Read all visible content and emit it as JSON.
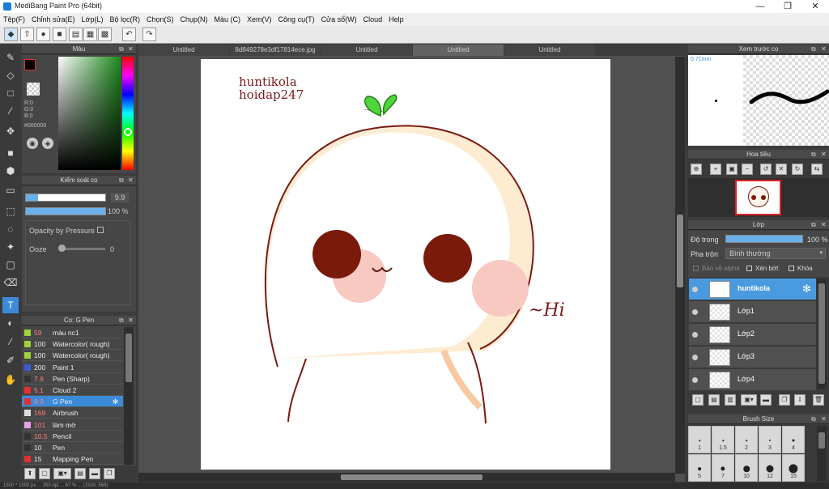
{
  "app": {
    "title": "MediBang Paint Pro (64bit)",
    "minimize": "—",
    "maximize": "❐",
    "close": "✕"
  },
  "menu": [
    "Tệp(F)",
    "Chỉnh sửa(E)",
    "Lớp(L)",
    "Bộ lọc(R)",
    "Chọn(S)",
    "Chụp(N)",
    "Màu (C)",
    "Xem(V)",
    "Công cụ(T)",
    "Cửa sổ(W)",
    "Cloud",
    "Help"
  ],
  "toolbar_icons": [
    "◆",
    "⇧",
    "●",
    "■",
    "▤",
    "▦",
    "▩",
    "↶",
    "↷"
  ],
  "tools": [
    "✎",
    "◇",
    "□",
    "∕",
    "✥",
    "■",
    "⬢",
    "▭",
    "⬚",
    "◌",
    "✦",
    "▢",
    "⌫",
    "T",
    "◐",
    "∕",
    "✐",
    "✋"
  ],
  "color_panel": {
    "title": "Màu",
    "r": "R:0",
    "g": "G:0",
    "b": "B:0",
    "hex": "#000000",
    "fg": "#000000",
    "bg": "#ffffff"
  },
  "brush_control": {
    "title": "Kiểm soát cọ",
    "size": "9.9",
    "opacity": "100 %",
    "pressure_label": "Opacity by Pressure",
    "ooze_label": "Ooze",
    "ooze_value": "0",
    "size_fill": 0.15,
    "opacity_fill": 1.0
  },
  "brush_list": {
    "title": "Cọ: G Pen",
    "items": [
      {
        "size": "59",
        "name": "màu nc1",
        "color": "#9fd23c",
        "size_red": true,
        "selected": false
      },
      {
        "size": "100",
        "name": "Watercolor( rough)",
        "color": "#9fd23c",
        "size_red": false,
        "selected": false
      },
      {
        "size": "100",
        "name": "Watercolor( rough)",
        "color": "#9fd23c",
        "size_red": false,
        "selected": false
      },
      {
        "size": "200",
        "name": "Paint 1",
        "color": "#3a5ad8",
        "size_red": false,
        "selected": false
      },
      {
        "size": "7.6",
        "name": "Pen (Sharp)",
        "color": "#333333",
        "size_red": true,
        "selected": false
      },
      {
        "size": "5.1",
        "name": "Cloud 2",
        "color": "#e03030",
        "size_red": true,
        "selected": false
      },
      {
        "size": "9.9",
        "name": "G Pen",
        "color": "#e03030",
        "size_red": true,
        "selected": true
      },
      {
        "size": "169",
        "name": "Airbrush",
        "color": "#dddddd",
        "size_red": true,
        "selected": false
      },
      {
        "size": "101",
        "name": "làm mờ",
        "color": "#e8a0e8",
        "size_red": true,
        "selected": false
      },
      {
        "size": "10.5",
        "name": "Pencil",
        "color": "#333333",
        "size_red": true,
        "selected": false
      },
      {
        "size": "10",
        "name": "Pen",
        "color": "#333333",
        "size_red": false,
        "selected": false
      },
      {
        "size": "15",
        "name": "Mapping Pen",
        "color": "#e03030",
        "size_red": false,
        "selected": false
      }
    ]
  },
  "tabs": [
    {
      "label": "Untitled",
      "active": false
    },
    {
      "label": "8d849278e3df17814ece.jpg",
      "active": false
    },
    {
      "label": "Untitled",
      "active": false
    },
    {
      "label": "Untitled",
      "active": true
    },
    {
      "label": "Untitled",
      "active": false
    }
  ],
  "artwork": {
    "line1": "huntikola",
    "line2": "hoidap247",
    "sign": "~Hi"
  },
  "preview": {
    "title": "Xem trước cọ",
    "size": "0.71mm"
  },
  "navigator": {
    "title": "Hoa tiêu"
  },
  "layers": {
    "title": "Lớp",
    "opacity_label": "Độ trong",
    "opacity_value": "100 %",
    "opacity_fill": 1.0,
    "blend_label": "Pha trộn",
    "blend_value": "Bình thường",
    "protect_alpha": "Bảo vệ alpha",
    "clipping": "Xén bớt",
    "lock": "Khóa",
    "items": [
      {
        "name": "huntikola",
        "selected": true
      },
      {
        "name": "Lớp1",
        "selected": false
      },
      {
        "name": "Lớp2",
        "selected": false
      },
      {
        "name": "Lớp3",
        "selected": false
      },
      {
        "name": "Lớp4",
        "selected": false
      }
    ]
  },
  "brush_size": {
    "title": "Brush Size",
    "sizes": [
      "1",
      "1.5",
      "2",
      "3",
      "4",
      "5",
      "7",
      "10",
      "12",
      "15"
    ]
  },
  "status": {
    "text": "1500 * 1500 px ... 350 dpi ... 67 % ... (1500, 566)"
  }
}
